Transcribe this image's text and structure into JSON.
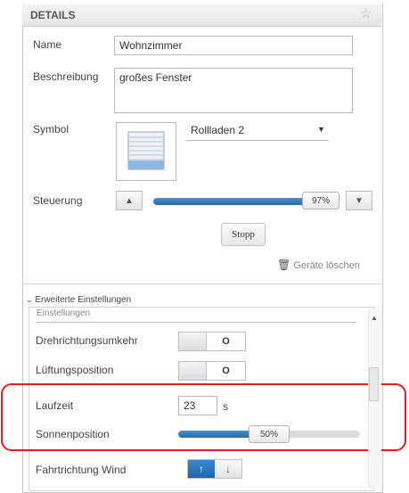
{
  "header": {
    "title": "DETAILS",
    "star_icon": "star-icon"
  },
  "form": {
    "name_label": "Name",
    "name_value": "Wohnzimmer",
    "desc_label": "Beschreibung",
    "desc_value": "großes Fenster",
    "symbol_label": "Symbol",
    "symbol_select": "Rollladen 2",
    "control_label": "Steuerung",
    "control_value_text": "97%",
    "control_value": 97,
    "stop_label": "Stopp",
    "delete_label": "Geräte löschen"
  },
  "advanced": {
    "title": "Erweiterte Einstellungen",
    "section_label": "Einstellungen",
    "reverse_label": "Drehrichtungsumkehr",
    "reverse_state": "O",
    "vent_label": "Lüftungsposition",
    "vent_state": "O",
    "runtime_label": "Laufzeit",
    "runtime_value": "23",
    "runtime_unit": "s",
    "sun_label": "Sonnenposition",
    "sun_value_text": "50%",
    "sun_value": 50,
    "wind_label": "Fahrtrichtung Wind",
    "wind_up": "↑",
    "wind_down": "↓"
  },
  "colors": {
    "accent": "#2c6aa8",
    "highlight": "#e21e1e"
  }
}
